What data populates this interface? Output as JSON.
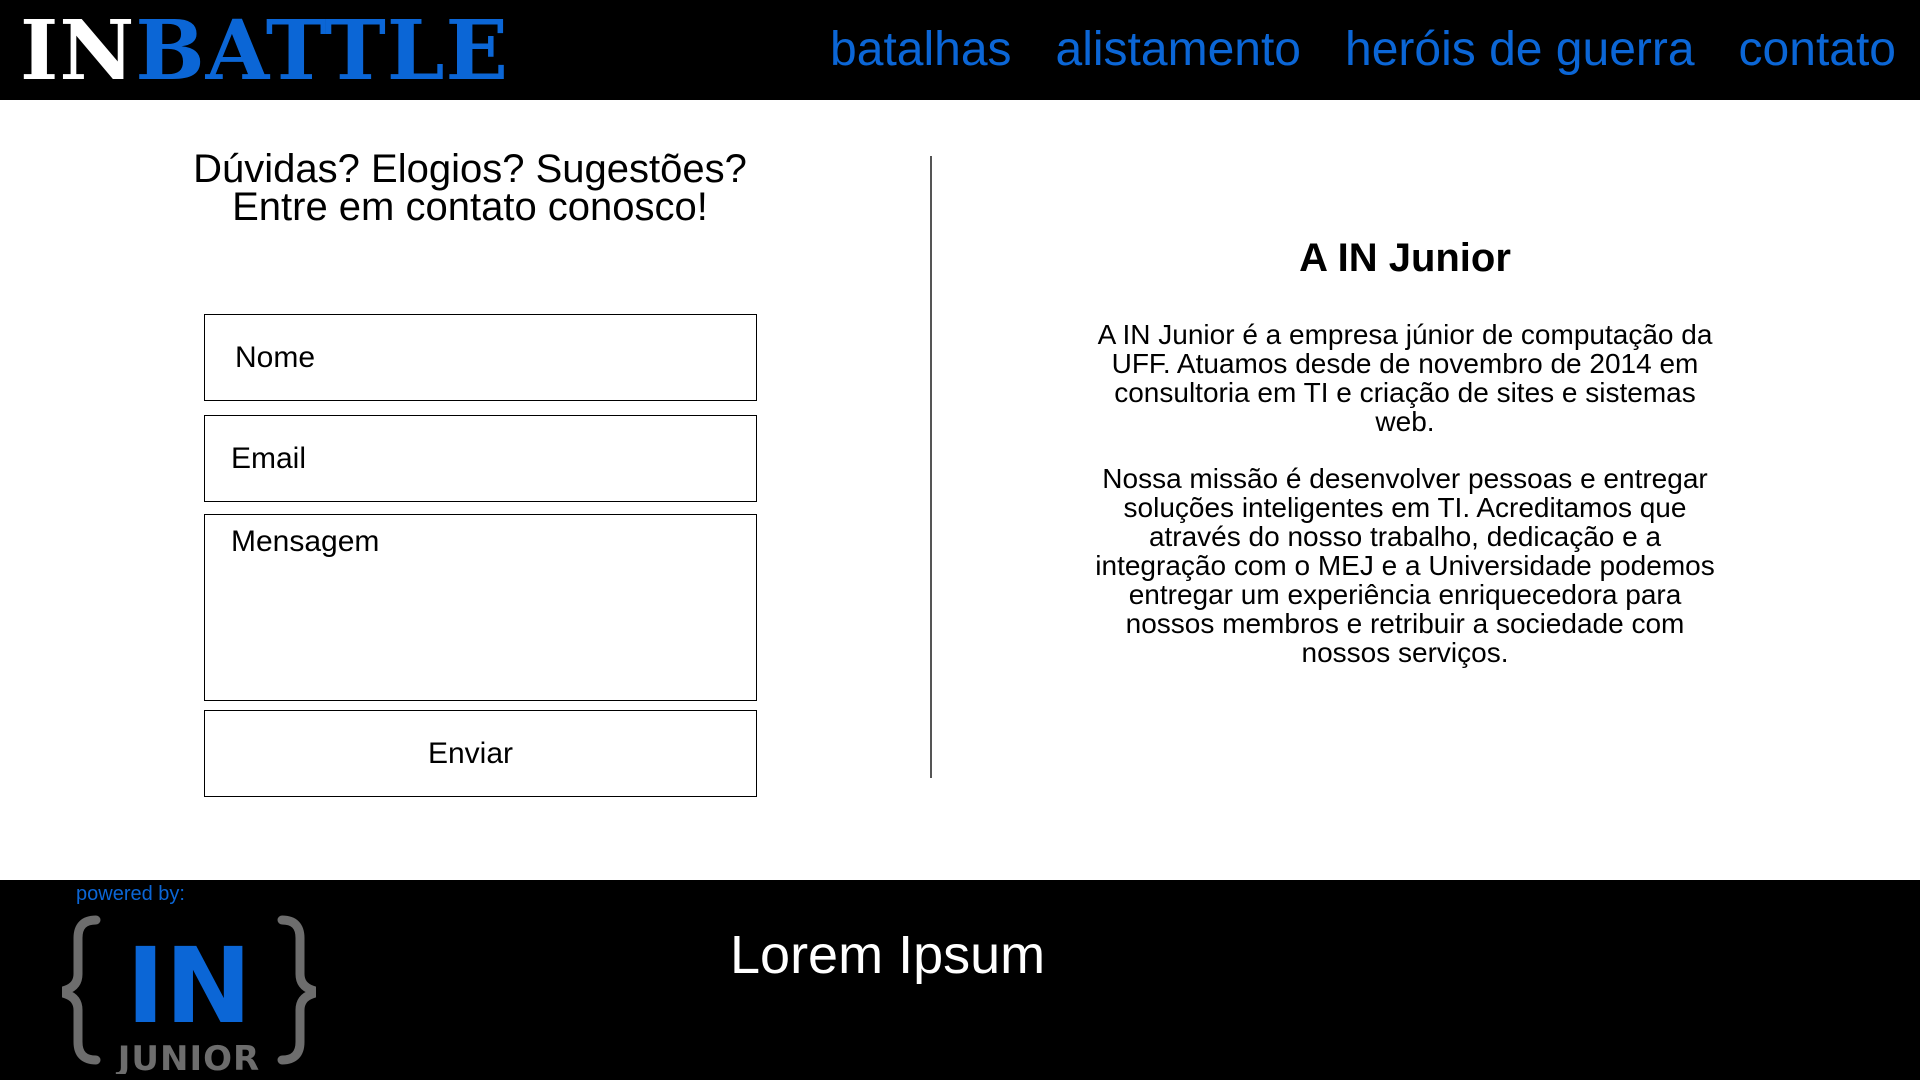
{
  "header": {
    "logo": {
      "part_1": "IN",
      "part_2": "BATTLE"
    },
    "nav": [
      {
        "label": "batalhas"
      },
      {
        "label": "alistamento"
      },
      {
        "label": "heróis de guerra"
      },
      {
        "label": "contato"
      }
    ]
  },
  "contact": {
    "heading_line_1": "Dúvidas? Elogios? Sugestões?",
    "heading_line_2": "Entre em contato conosco!",
    "name_placeholder": "Nome",
    "email_placeholder": "Email",
    "message_placeholder": "Mensagem",
    "submit_label": "Enviar"
  },
  "about": {
    "title": "A IN Junior",
    "paragraph_1": "A IN Junior é a empresa júnior de computação da UFF. Atuamos desde de novembro de 2014 em consultoria em TI e criação de sites e sistemas web.",
    "paragraph_2": "Nossa missão é desenvolver pessoas e entregar soluções inteligentes em TI. Acreditamos que através do nosso trabalho, dedicação e a integração com o MEJ e a Universidade podemos entregar um experiência enriquecedora para nossos membros e retribuir a sociedade com nossos serviços."
  },
  "footer": {
    "powered_by": "powered by:",
    "logo_text": "IN",
    "logo_subtext": "JUNIOR",
    "text": "Lorem Ipsum"
  },
  "colors": {
    "brand_blue": "#0b66d6",
    "header_bg": "#000000",
    "footer_bg": "#000000",
    "logo_gray": "#6d6d6d"
  }
}
